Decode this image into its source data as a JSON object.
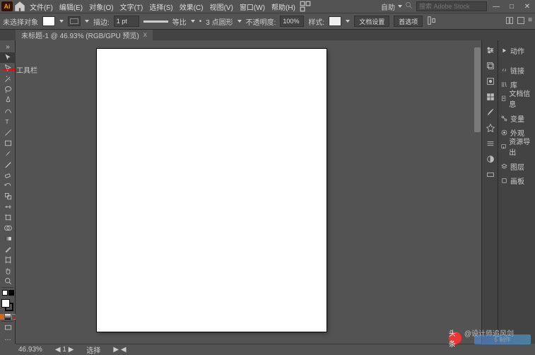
{
  "menubar": {
    "items": [
      "文件(F)",
      "编辑(E)",
      "对象(O)",
      "文字(T)",
      "选择(S)",
      "效果(C)",
      "视图(V)",
      "窗口(W)",
      "帮助(H)"
    ],
    "extra_icon": "layout-icon",
    "right": {
      "label": "自助",
      "search_placeholder": "搜索 Adobe Stock"
    }
  },
  "optionsbar": {
    "noselect": "未选择对象",
    "stroke_label": "描边:",
    "stroke_val": "1 pt",
    "uniform": "等比",
    "pt_count": "3 点圆形",
    "opacity_label": "不透明度:",
    "opacity_val": "100%",
    "style_label": "样式:",
    "btn1": "文档设置",
    "btn2": "首选项"
  },
  "doc_tab": {
    "title": "未标题-1 @ 46.93% (RGB/GPU 预览)",
    "close": "x"
  },
  "annotation": "工具栏",
  "panels": {
    "items": [
      {
        "icon": "play",
        "label": "动作"
      },
      {
        "icon": "link",
        "label": "链接"
      },
      {
        "icon": "books",
        "label": "库"
      },
      {
        "icon": "doc",
        "label": "文档信息"
      },
      {
        "icon": "var",
        "label": "变量"
      },
      {
        "icon": "eye",
        "label": "外观"
      },
      {
        "icon": "export",
        "label": "资源导出"
      },
      {
        "icon": "layers",
        "label": "图层"
      },
      {
        "icon": "artb",
        "label": "画板"
      }
    ]
  },
  "statusbar": {
    "zoom": "46.93%",
    "nav": "◀  1  ▶",
    "sel": "选择",
    "blend": "▶ ◀"
  },
  "watermark": {
    "text": "@设计师追风剑",
    "logo": "头条"
  },
  "wm2": "5 制作"
}
